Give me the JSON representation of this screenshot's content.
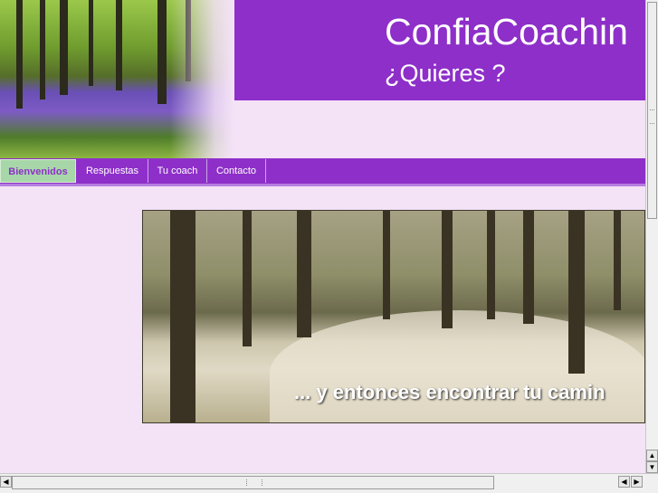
{
  "header": {
    "title": "ConfiaCoachin",
    "tagline": "¿Quieres ?"
  },
  "nav": {
    "items": [
      {
        "label": "Bienvenidos",
        "active": true
      },
      {
        "label": "Respuestas",
        "active": false
      },
      {
        "label": "Tu coach",
        "active": false
      },
      {
        "label": "Contacto",
        "active": false
      }
    ]
  },
  "banner": {
    "caption": "... y entonces encontrar tu camin"
  },
  "scrollbars": {
    "left_arrow": "◀",
    "right_arrow": "▶",
    "up_arrow": "▲",
    "down_arrow": "▼"
  },
  "colors": {
    "accent": "#8e2fc9",
    "page_background": "#f4e2f7",
    "active_tab": "#a7d7a8"
  }
}
